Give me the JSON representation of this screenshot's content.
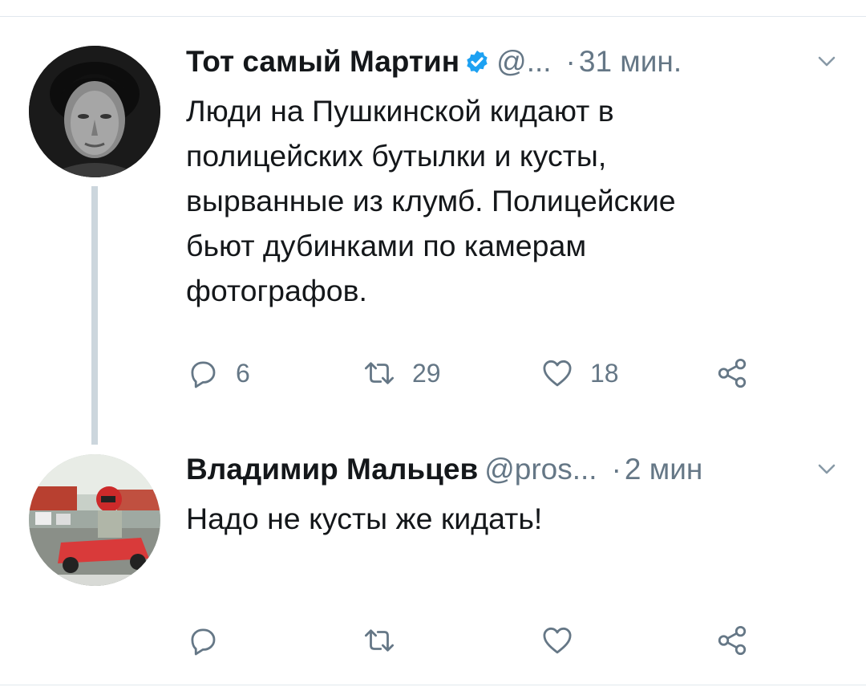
{
  "tweets": [
    {
      "author_name": "Тот самый Мартин",
      "handle": "@...",
      "separator": "·",
      "time": "31 мин.",
      "text": "Люди на Пушкинской кидают в\nполицейских бутылки и кусты,\nвырванные из клумб. Полицейские\nбьют дубинками по камерам\nфотографов.",
      "verified": true,
      "actions": {
        "reply_count": "6",
        "retweet_count": "29",
        "like_count": "18"
      }
    },
    {
      "author_name": "Владимир Мальцев",
      "handle": "@pros...",
      "separator": "·",
      "time": "2 мин",
      "text": "Надо не кусты же кидать!",
      "verified": false,
      "actions": {
        "reply_count": "",
        "retweet_count": "",
        "like_count": ""
      }
    }
  ],
  "icons": {
    "reply": "reply-icon",
    "retweet": "retweet-icon",
    "like": "heart-icon",
    "share": "share-icon",
    "verified": "verified-badge-icon",
    "caret": "chevron-down-icon"
  },
  "colors": {
    "text": "#14171a",
    "secondary": "#657786",
    "verified": "#1da1f2",
    "thread_line": "#ccd6dd"
  }
}
